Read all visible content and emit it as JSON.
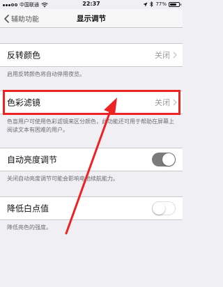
{
  "status_bar": {
    "carrier": "中国联通",
    "time": "22:37",
    "battery_percent": "77%",
    "battery_level": 0.77
  },
  "nav": {
    "back_label": "辅助功能",
    "title": "显示调节"
  },
  "rows": {
    "invert": {
      "label": "反转颜色",
      "value": "关闭",
      "footer": "启用反转颜色将自动停用夜览。"
    },
    "color_filters": {
      "label": "色彩滤镜",
      "value": "关闭",
      "footer": "色盲用户可使用色彩滤镜来区分颜色，此功能还可用于帮助在屏幕上阅读文本有困难的用户。"
    },
    "auto_brightness": {
      "label": "自动亮度调节",
      "toggle_on": true,
      "footer": "关闭自动亮度调节可能会影响电池续航能力。"
    },
    "reduce_white_point": {
      "label": "降低白点值",
      "toggle_on": false,
      "footer": "降低亮色的强度。"
    }
  },
  "annotation": {
    "highlight_color": "#ee2222"
  }
}
